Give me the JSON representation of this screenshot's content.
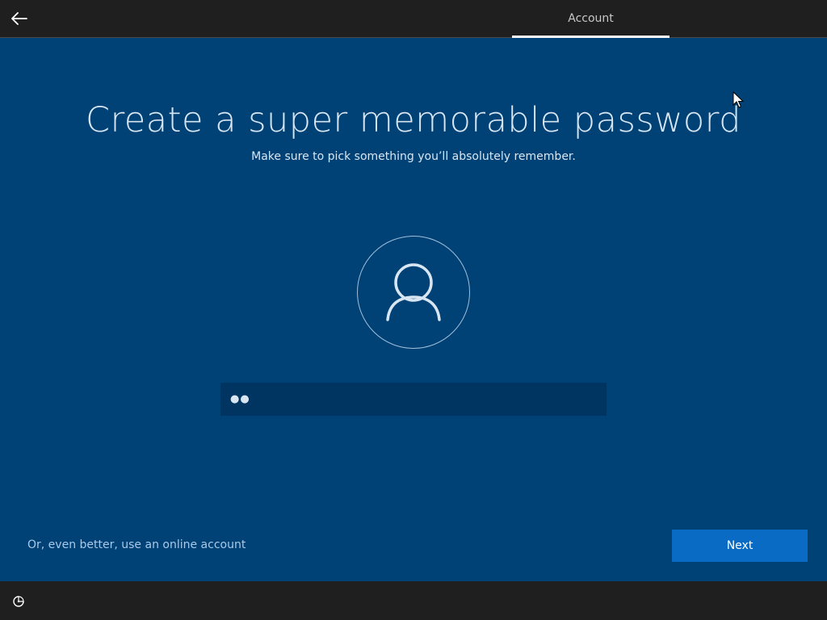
{
  "header": {
    "back_icon": "back-arrow-icon",
    "tabs": [
      {
        "label": "Account",
        "active": true
      }
    ]
  },
  "main": {
    "title": "Create a super memorable password",
    "subtitle": "Make sure to pick something you’ll absolutely remember.",
    "avatar_icon": "user-icon",
    "password_field": {
      "value": "●●",
      "type": "password"
    },
    "online_account_link": "Or, even better, use an online account",
    "next_button": "Next"
  },
  "footer": {
    "ease_of_access_icon": "ease-of-access-icon"
  },
  "colors": {
    "background": "#004275",
    "bars": "#1f1f1f",
    "primary_button": "#0a6bc4",
    "link": "#a9c9ea"
  }
}
